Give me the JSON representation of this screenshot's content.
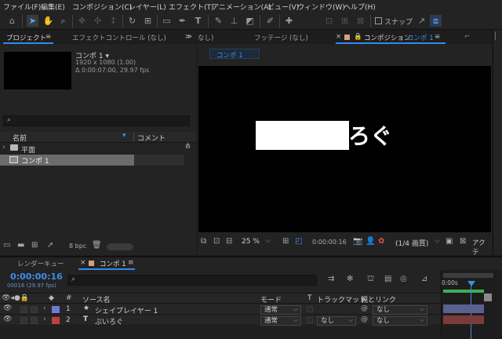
{
  "menu": [
    "ファイル(F)",
    "編集(E)",
    "コンポジション(C)",
    "レイヤー(L)",
    "エフェクト(T)",
    "アニメーション(A)",
    "ビュー(V)",
    "ウィンドウ(W)",
    "ヘルプ(H)"
  ],
  "toolbar": {
    "snap_label": "スナップ"
  },
  "project_panel": {
    "tab_project": "プロジェクト",
    "tab_effect_controls": "エフェクトコントロール (なし)",
    "comp_name": "コンポ 1 ▾",
    "resolution": "1920 x 1080 (1.00)",
    "duration": "Δ 0:00:07:00, 29.97 fps",
    "search_placeholder": "",
    "col_name": "名前",
    "col_comment": "コメント",
    "items": [
      {
        "name": "平面",
        "kind": "folder"
      },
      {
        "name": "コンポ 1",
        "kind": "comp"
      }
    ],
    "bpc": "8 bpc"
  },
  "comp_panel": {
    "tab_prev_fragment": "なし)",
    "tab_footage": "フッテージ (なし)",
    "tab_comp_prefix": "コンポジション",
    "tab_comp_name": "コンポ 1",
    "tab_more": "≫",
    "breadcrumb": "コンポ 1",
    "viewer_text": "ろぐ",
    "zoom": "25 %",
    "timecode": "0:00:00:16",
    "resolution": "(1/4 画質)",
    "active_camera": "アクテ"
  },
  "timeline": {
    "tab_render_queue": "レンダーキュー",
    "tab_comp": "コンポ 1",
    "timecode": "0:00:00:16",
    "frame_info": "00016 (29.97 fps)",
    "search_placeholder": "",
    "col_hash": "#",
    "col_source": "ソース名",
    "col_mode": "モード",
    "col_t": "T",
    "col_trackmatte": "トラックマット",
    "col_parent": "親とリンク",
    "ruler_label": "0:00s",
    "layers": [
      {
        "num": "1",
        "type_icon": "★",
        "name": "シェイプレイヤー 1",
        "mode": "通常",
        "trackmatte": "",
        "parent": "なし",
        "color": "#6b7bd6"
      },
      {
        "num": "2",
        "type_icon": "T",
        "name": "ぷいろぐ",
        "mode": "通常",
        "trackmatte": "なし",
        "parent": "なし",
        "color": "#c0403c"
      }
    ]
  }
}
